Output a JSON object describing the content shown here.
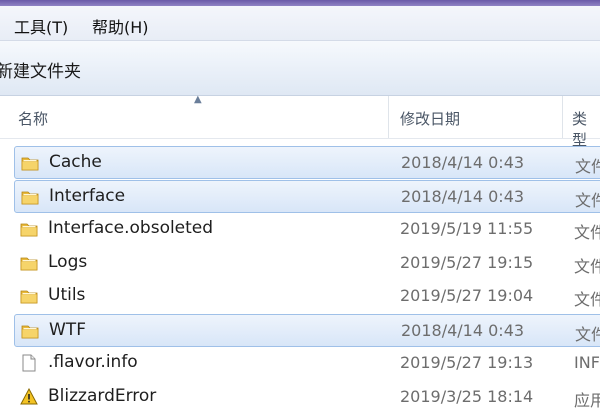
{
  "menubar": {
    "tools": "工具(T)",
    "help": "帮助(H)"
  },
  "toolbar": {
    "new_folder": "新建文件夹"
  },
  "columns": {
    "name": "名称",
    "modified": "修改日期",
    "type": "类型"
  },
  "files": [
    {
      "name": "Cache",
      "modified": "2018/4/14 0:43",
      "type": "文件",
      "kind": "folder",
      "selected": true
    },
    {
      "name": "Interface",
      "modified": "2018/4/14 0:43",
      "type": "文件",
      "kind": "folder",
      "selected": true
    },
    {
      "name": "Interface.obsoleted",
      "modified": "2019/5/19 11:55",
      "type": "文件",
      "kind": "folder",
      "selected": false
    },
    {
      "name": "Logs",
      "modified": "2019/5/27 19:15",
      "type": "文件",
      "kind": "folder",
      "selected": false
    },
    {
      "name": "Utils",
      "modified": "2019/5/27 19:04",
      "type": "文件",
      "kind": "folder",
      "selected": false
    },
    {
      "name": "WTF",
      "modified": "2018/4/14 0:43",
      "type": "文件",
      "kind": "folder",
      "selected": true
    },
    {
      "name": ".flavor.info",
      "modified": "2019/5/27 19:13",
      "type": "INF",
      "kind": "file",
      "selected": false
    },
    {
      "name": "BlizzardError",
      "modified": "2019/3/25 18:14",
      "type": "应用",
      "kind": "warning",
      "selected": false
    }
  ]
}
